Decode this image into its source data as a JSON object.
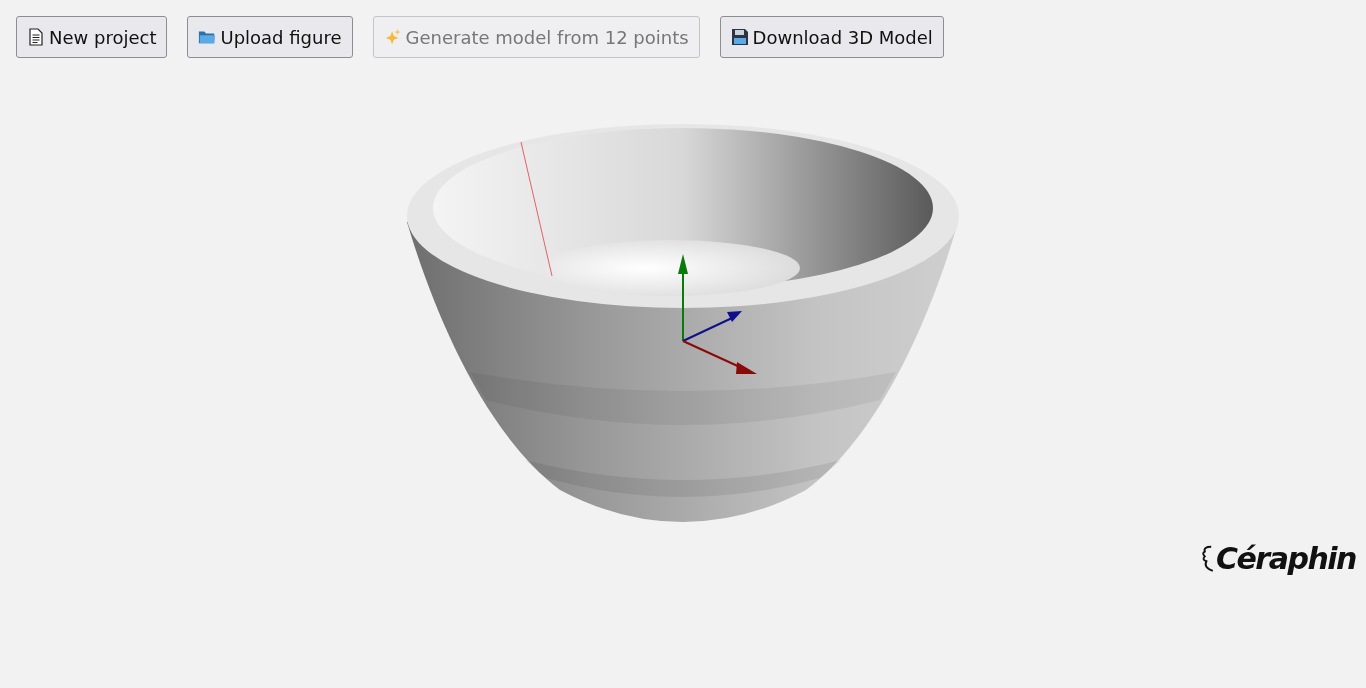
{
  "toolbar": {
    "buttons": [
      {
        "label": "New project",
        "kind": "document",
        "disabled": false
      },
      {
        "label": "Upload figure",
        "kind": "folder",
        "disabled": false
      },
      {
        "label": "Generate model from 12 points",
        "kind": "sparkles",
        "disabled": true
      },
      {
        "label": "Download 3D Model",
        "kind": "floppy",
        "disabled": false
      }
    ]
  },
  "logo": {
    "text": "Céraphin"
  }
}
